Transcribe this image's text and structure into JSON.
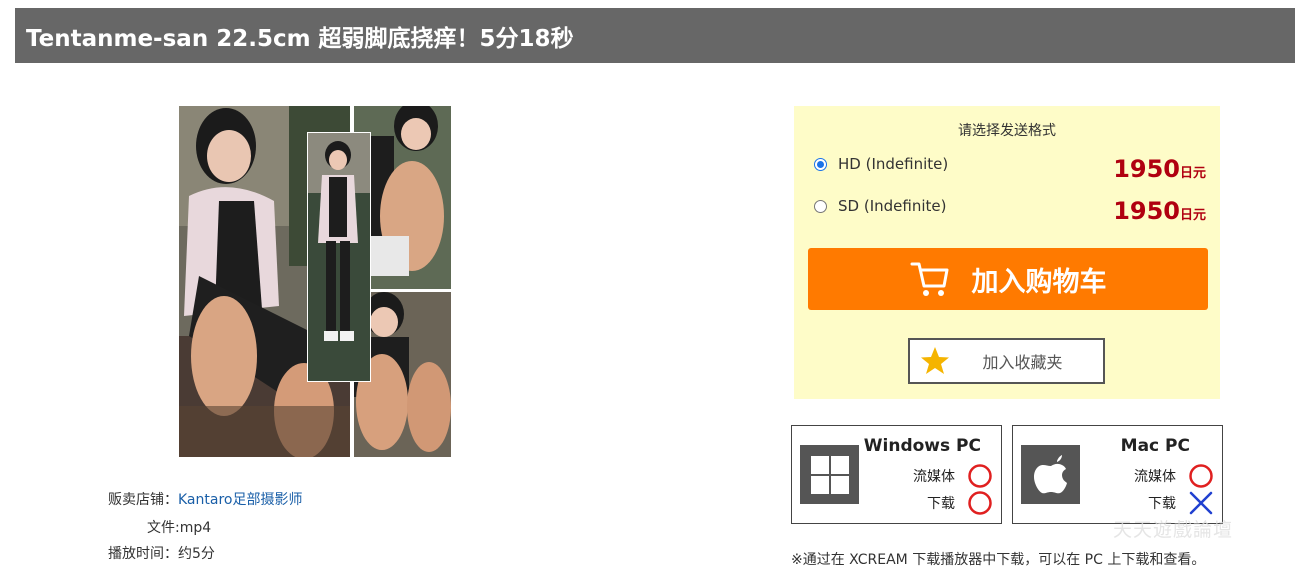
{
  "page": {
    "title": "Tentanme-san 22.5cm 超弱脚底挠痒！5分18秒"
  },
  "product_meta": {
    "shop_label": "贩卖店铺：",
    "shop_name": "Kantaro足部摄影师",
    "file_label": "文件:",
    "file_value": "mp4",
    "duration_label": "播放时间：",
    "duration_value": "约5分"
  },
  "purchase": {
    "heading": "请选择发送格式",
    "options": [
      {
        "label": "HD (Indefinite)",
        "price": "1950",
        "currency": "日元",
        "selected": true
      },
      {
        "label": "SD (Indefinite)",
        "price": "1950",
        "currency": "日元",
        "selected": false
      }
    ],
    "cart_label": "加入购物车",
    "favorite_label": "加入收藏夹",
    "accent_color": "#ff7a00",
    "price_color": "#b00010"
  },
  "compatibility": {
    "windows": {
      "name": "Windows PC",
      "stream_label": "流媒体",
      "stream_ok": "○",
      "download_label": "下载",
      "download_ok": "○"
    },
    "mac": {
      "name": "Mac PC",
      "stream_label": "流媒体",
      "stream_ok": "○",
      "download_label": "下载",
      "download_ok": "×"
    }
  },
  "footer_note": "※通过在 XCREAM 下载播放器中下载，可以在 PC 上下载和查看。",
  "watermark": "天天遊戲論壇"
}
